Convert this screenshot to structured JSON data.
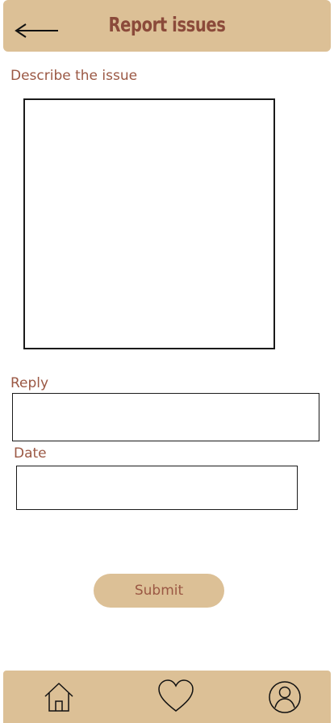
{
  "header": {
    "title": "Report issues",
    "back_icon": "arrow-left-icon"
  },
  "form": {
    "describe_label": "Describe the issue",
    "describe_value": "",
    "reply_label": "Reply",
    "reply_value": "",
    "date_label": "Date",
    "date_value": "",
    "submit_label": "Submit"
  },
  "nav": {
    "items": [
      {
        "icon": "home-icon"
      },
      {
        "icon": "heart-icon"
      },
      {
        "icon": "user-circle-icon"
      }
    ]
  },
  "colors": {
    "accent": "#dcc096",
    "title_text": "#8b4a3a",
    "label_text": "#9b5844"
  }
}
